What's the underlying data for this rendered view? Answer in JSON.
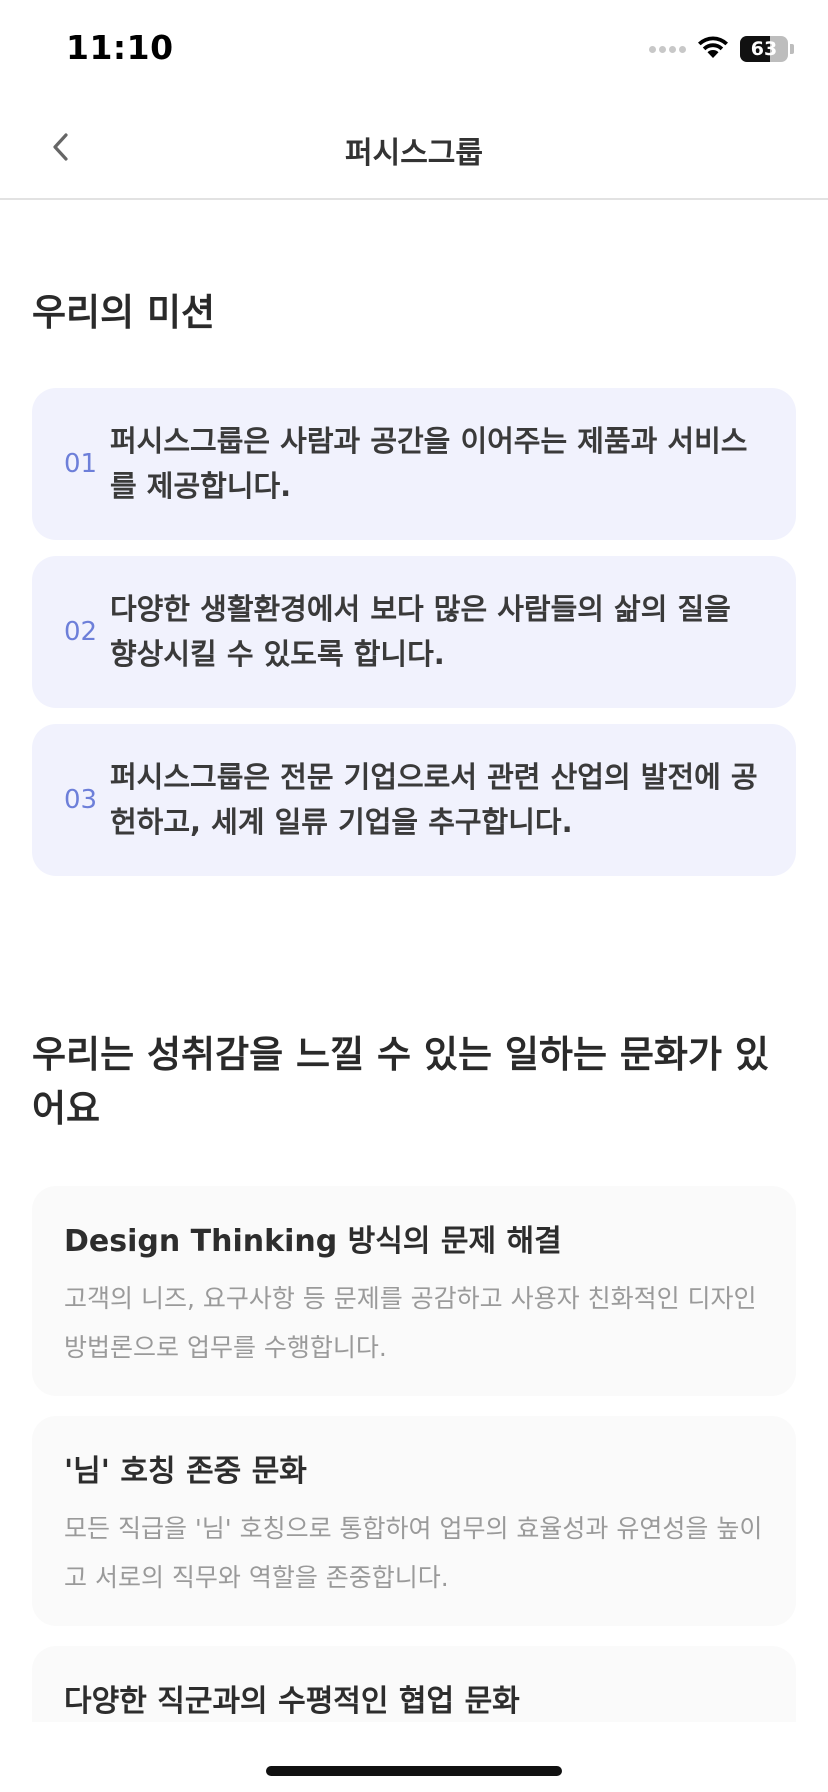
{
  "status_bar": {
    "time": "11:10",
    "battery_level": "63",
    "battery_fraction": 0.63,
    "icons": [
      "cellular-signal-icon",
      "wifi-icon",
      "battery-icon"
    ]
  },
  "nav": {
    "title": "퍼시스그룹",
    "back_icon": "chevron-left-icon"
  },
  "mission": {
    "title": "우리의 미션",
    "items": [
      {
        "number": "01",
        "text": "퍼시스그룹은 사람과 공간을 이어주는 제품과 서비스를 제공합니다."
      },
      {
        "number": "02",
        "text": "다양한 생활환경에서 보다 많은 사람들의 삶의 질을 향상시킬 수 있도록 합니다."
      },
      {
        "number": "03",
        "text": "퍼시스그룹은 전문 기업으로서 관련 산업의 발전에 공헌하고, 세계 일류 기업을 추구합니다."
      }
    ]
  },
  "culture": {
    "title": "우리는 성취감을 느낄 수 있는 일하는 문화가 있어요",
    "items": [
      {
        "heading": "Design Thinking 방식의 문제 해결",
        "description": "고객의 니즈, 요구사항 등 문제를 공감하고 사용자 친화적인 디자인 방법론으로 업무를 수행합니다."
      },
      {
        "heading": "'님' 호칭 존중 문화",
        "description": "모든 직급을 '님' 호칭으로 통합하여 업무의 효율성과 유연성을 높이고 서로의 직무와 역할을 존중합니다."
      },
      {
        "heading": "다양한 직군과의 수평적인 협업 문화",
        "description": ""
      }
    ]
  },
  "colors": {
    "accent": "#6d7fd9",
    "mission_card_bg": "#f1f2fd",
    "culture_card_bg": "#fafafa"
  }
}
